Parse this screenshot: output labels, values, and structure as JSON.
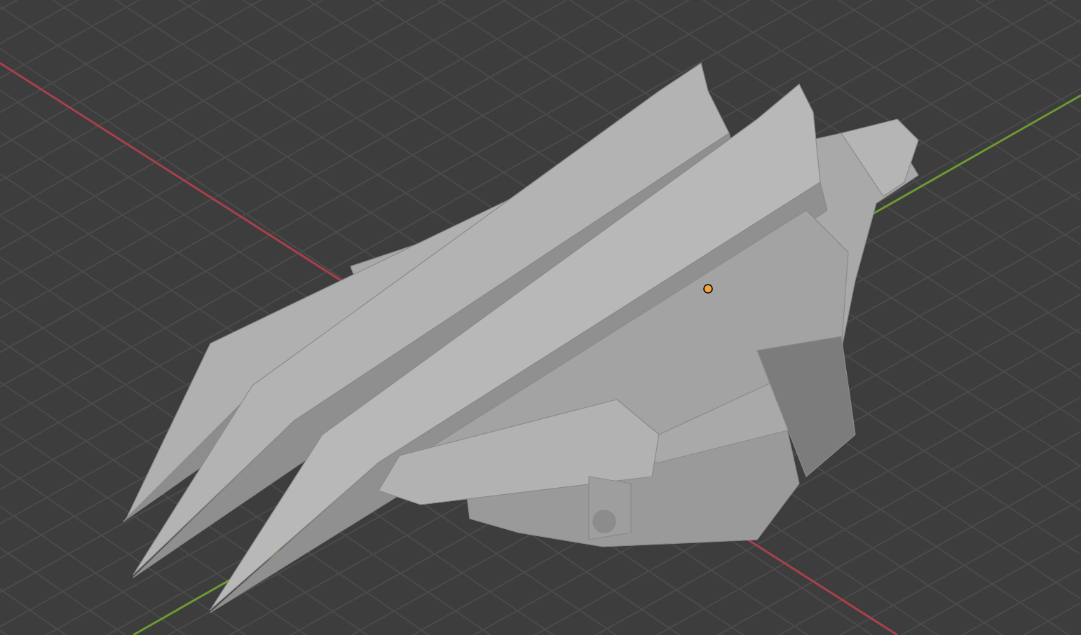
{
  "viewport": {
    "axes": [
      {
        "kind": "x",
        "color": "#a8404c"
      },
      {
        "kind": "y",
        "color": "#6e9a30"
      }
    ],
    "origin": {
      "selected": true
    }
  }
}
